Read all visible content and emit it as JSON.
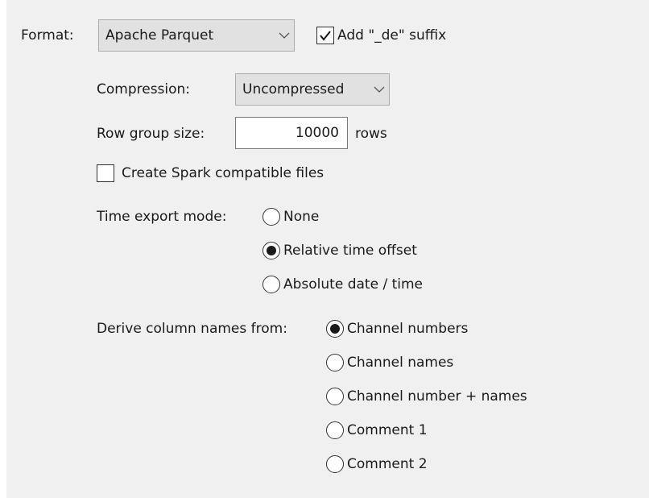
{
  "format": {
    "label": "Format:",
    "value": "Apache Parquet",
    "suffix_checkbox": {
      "label": "Add \"_de\" suffix",
      "checked": true
    }
  },
  "compression": {
    "label": "Compression:",
    "value": "Uncompressed"
  },
  "row_group": {
    "label": "Row group size:",
    "value": "10000",
    "unit": "rows"
  },
  "spark": {
    "label": "Create Spark compatible files",
    "checked": false
  },
  "time_export": {
    "label": "Time export mode:",
    "options": [
      {
        "label": "None",
        "checked": false
      },
      {
        "label": "Relative time offset",
        "checked": true
      },
      {
        "label": "Absolute date / time",
        "checked": false
      }
    ]
  },
  "column_names": {
    "label": "Derive column names from:",
    "options": [
      {
        "label": "Channel numbers",
        "checked": true
      },
      {
        "label": "Channel names",
        "checked": false
      },
      {
        "label": "Channel number + names",
        "checked": false
      },
      {
        "label": "Comment 1",
        "checked": false
      },
      {
        "label": "Comment 2",
        "checked": false
      }
    ]
  },
  "colors": {
    "panel_background": "#f0f0f0",
    "combo_background": "#e1e1e1"
  },
  "icons": {
    "dropdown": "chevron-down-icon",
    "check": "checkmark-icon"
  }
}
